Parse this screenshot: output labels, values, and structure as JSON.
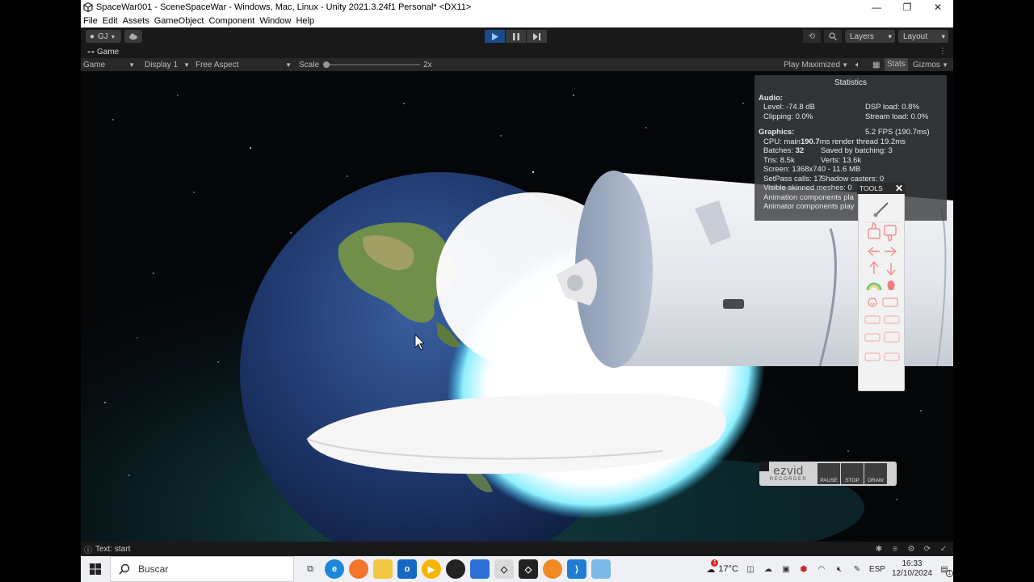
{
  "window": {
    "title": "SpaceWar001 - SceneSpaceWar - Windows, Mac, Linux - Unity 2021.3.24f1 Personal* <DX11>",
    "minimize": "—",
    "maximize": "❐",
    "close": "✕"
  },
  "menu": [
    "File",
    "Edit",
    "Assets",
    "GameObject",
    "Component",
    "Window",
    "Help"
  ],
  "toolbar": {
    "account": "GJ",
    "layers": "Layers",
    "layout": "Layout"
  },
  "tab": {
    "label": "Game"
  },
  "gamebar": {
    "view": "Game",
    "display": "Display 1",
    "aspect": "Free Aspect",
    "scale_label": "Scale",
    "scale_value": "2x",
    "play_mode": "Play Maximized",
    "stats": "Stats",
    "gizmos": "Gizmos"
  },
  "stats": {
    "title": "Statistics",
    "audio_head": "Audio:",
    "level": "Level: -74.8 dB",
    "dsp": "DSP load: 0.8%",
    "clipping": "Clipping: 0.0%",
    "stream": "Stream load: 0.0%",
    "graphics_head": "Graphics:",
    "fps": "5.2 FPS (190.7ms)",
    "cpu_prefix": "CPU: main ",
    "cpu_main": "190.7",
    "cpu_suffix": "ms  render thread 19.2ms",
    "batches_prefix": "Batches: ",
    "batches": "32",
    "saved": "Saved by batching: 3",
    "tris": "Tris: 8.5k",
    "verts": "Verts: 13.6k",
    "screen": "Screen: 1368x740 - 11.6 MB",
    "setpass": "SetPass calls: 17",
    "shadow": "Shadow casters: 0",
    "skinned": "Visible skinned meshes: 0",
    "anim1": "Animation components pla",
    "anim2": "Animator components play"
  },
  "tools": {
    "label": "TOOLS",
    "close": "✕"
  },
  "ezvid": {
    "brand": "ezvid",
    "sub": "RECORDER",
    "pause": "PAUSE",
    "stop": "STOP",
    "draw": "DRAW"
  },
  "status": {
    "text": "Text: start"
  },
  "taskbar": {
    "search": "Buscar",
    "temp": "17°C",
    "lang": "ESP",
    "time": "16:33",
    "date": "12/10/2024",
    "notif": "1",
    "weather_badge": "1"
  },
  "colors": {
    "play_active": "#1b4b8a",
    "editor_bg": "#191919",
    "stats_bg": "#3c3e42"
  }
}
